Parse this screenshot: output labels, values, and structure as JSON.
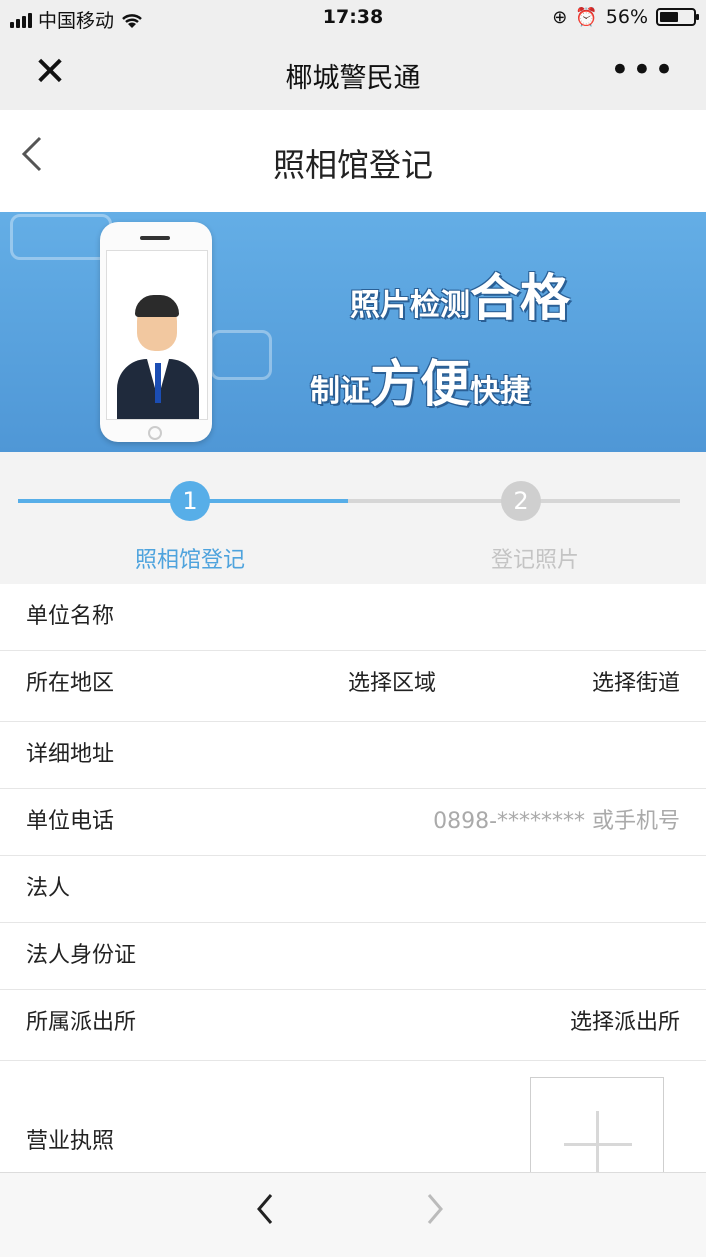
{
  "status_bar": {
    "carrier": "中国移动",
    "time": "17:38",
    "battery": "56%",
    "battery_level": 0.56
  },
  "wechat_bar": {
    "close_icon": "close-icon",
    "title": "椰城警民通",
    "more_icon": "more-icon"
  },
  "page": {
    "back_icon": "chevron-left-icon",
    "title": "照相馆登记"
  },
  "banner": {
    "line1_a": "照片检测",
    "line1_b": "合格",
    "line2_a": "制证",
    "line2_b": "方便",
    "line2_c": "快捷"
  },
  "steps": [
    {
      "number": "1",
      "label": "照相馆登记",
      "active": true
    },
    {
      "number": "2",
      "label": "登记照片",
      "active": false
    }
  ],
  "form": {
    "unit_name": "单位名称",
    "region": "所在地区",
    "region_select": "选择区域",
    "street_select": "选择街道",
    "address": "详细地址",
    "phone": "单位电话",
    "phone_placeholder": "0898-******** 或手机号",
    "legal_person": "法人",
    "legal_id": "法人身份证",
    "station": "所属派出所",
    "station_select": "选择派出所",
    "license": "营业执照"
  },
  "toolbar": {
    "prev_icon": "chevron-left-icon",
    "next_icon": "chevron-right-icon"
  },
  "colors": {
    "accent": "#57aee8",
    "inactive": "#cfcfcf"
  }
}
